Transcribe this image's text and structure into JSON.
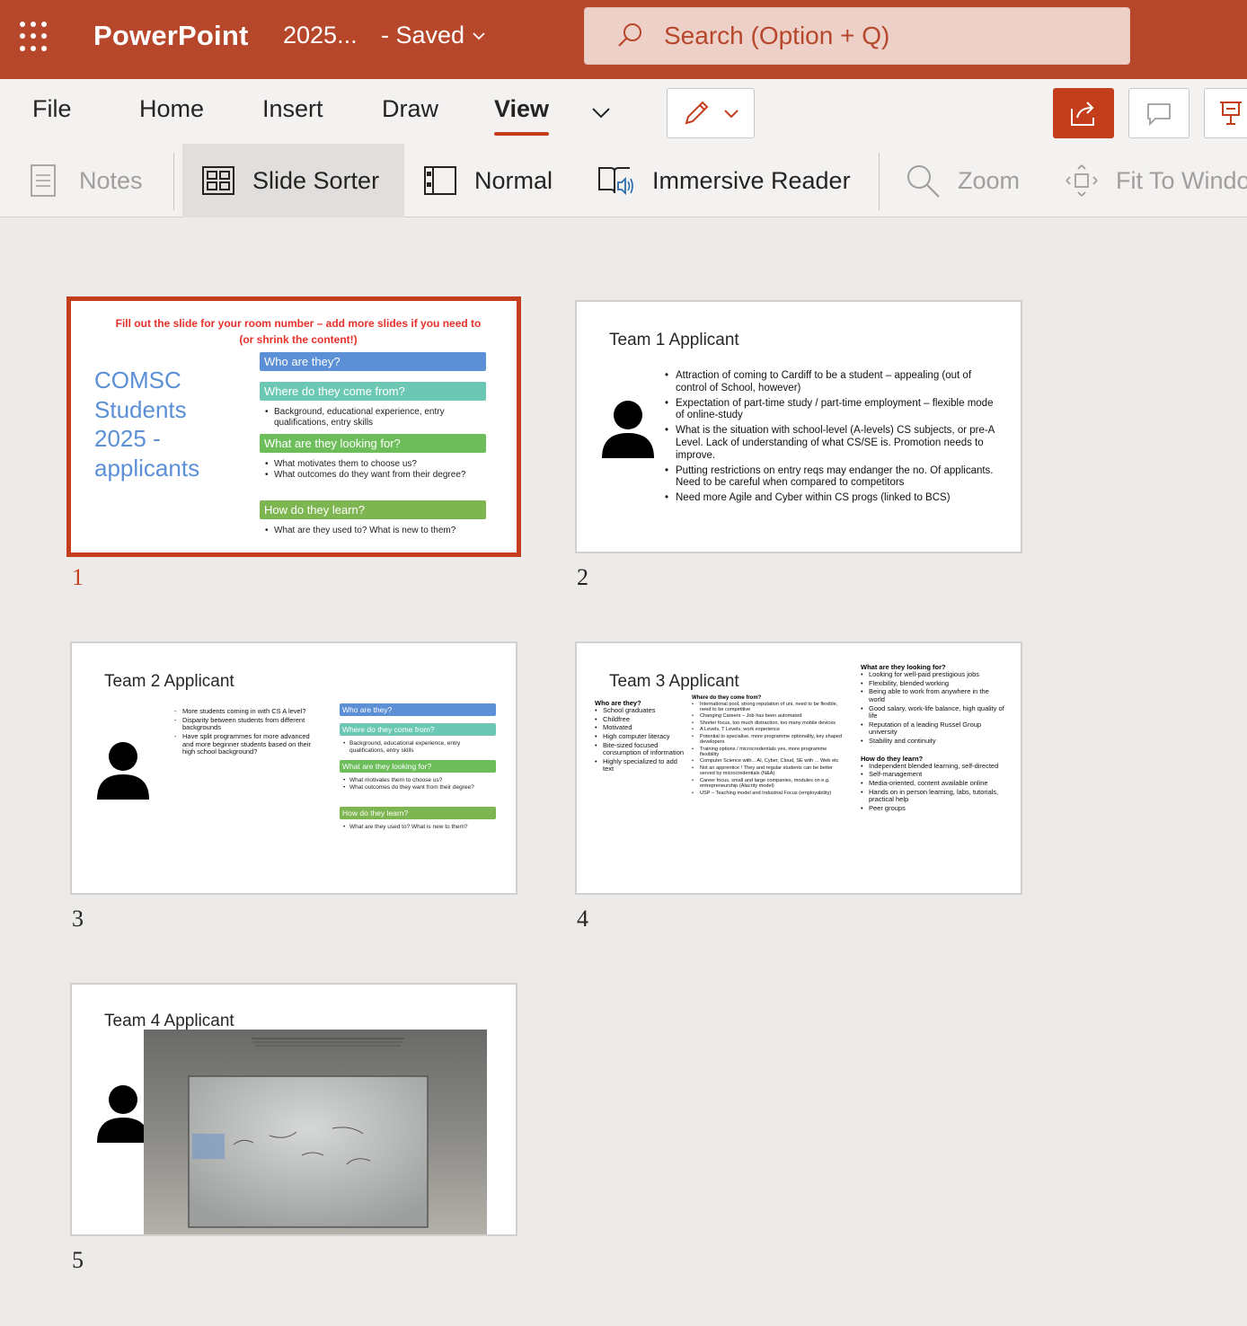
{
  "app": {
    "name": "PowerPoint",
    "doc_title": "2025...",
    "save_status": "-  Saved",
    "search_placeholder": "Search (Option + Q)"
  },
  "tabs": [
    "File",
    "Home",
    "Insert",
    "Draw",
    "View"
  ],
  "active_tab": "View",
  "commands": {
    "notes": "Notes",
    "slide_sorter": "Slide Sorter",
    "normal": "Normal",
    "immersive_reader": "Immersive Reader",
    "zoom": "Zoom",
    "fit_to_window": "Fit To Windo"
  },
  "colors": {
    "brand": "#b7472a",
    "accent": "#c43e1c"
  },
  "slides": [
    {
      "number": "1",
      "selected": true,
      "instruction": "Fill out the slide for your room number – add more slides if you need to (or shrink the content!)",
      "title_lines": [
        "COMSC",
        "Students",
        "2025 -",
        "applicants"
      ],
      "boxes": [
        {
          "label": "Who are they?",
          "bullets": []
        },
        {
          "label": "Where do they come from?",
          "bullets": [
            "Background, educational experience, entry qualifications, entry skills"
          ]
        },
        {
          "label": "What are they looking for?",
          "bullets": [
            "What motivates them to choose us?",
            "What outcomes do they want from their degree?"
          ]
        },
        {
          "label": "How do they learn?",
          "bullets": [
            "What are they used to? What is new to them?"
          ]
        }
      ]
    },
    {
      "number": "2",
      "title": "Team 1 Applicant",
      "bullets": [
        "Attraction of coming to Cardiff to be a student – appealing (out of control of School, however)",
        "Expectation of part-time study / part-time employment – flexible mode of online-study",
        "What is the situation with school-level (A-levels) CS subjects, or pre-A Level.  Lack of understanding of what CS/SE is.  Promotion needs to improve.",
        "Putting restrictions on entry reqs may endanger the no. Of applicants.  Need to be careful when compared to competitors",
        "Need more Agile and Cyber within CS progs (linked to BCS)"
      ]
    },
    {
      "number": "3",
      "title": "Team 2 Applicant",
      "bullets": [
        "More students coming in with CS A level?",
        "Disparity between students from different backgrounds",
        "Have split programmes for more advanced and more beginner students based on their high school background?"
      ],
      "boxes": [
        {
          "label": "Who are they?",
          "bullets": []
        },
        {
          "label": "Where do they come from?",
          "bullets": [
            "Background, educational experience, entry qualifications, entry skills"
          ]
        },
        {
          "label": "What are they looking for?",
          "bullets": [
            "What motivates them to choose us?",
            "What outcomes do they want from their degree?"
          ]
        },
        {
          "label": "How do they learn?",
          "bullets": [
            "What are they used to? What is new to them?"
          ]
        }
      ]
    },
    {
      "number": "4",
      "title": "Team 3 Applicant",
      "who_header": "Who are they?",
      "who": [
        "School graduates",
        "Childfree",
        "Motivated",
        "High computer literacy",
        "Bite-sized focused consumption of information",
        "Highly specialized to add text"
      ],
      "where_header": "Where do they come from?",
      "where": [
        "International pool, strong reputation of uni, need to be flexible, need to be competitive",
        "Changing Careers – Job has been automated",
        "Shorter focus, too much distraction, too many mobile devices",
        "A Levels, T Levels, work experience",
        "Potential to specialise, more programme optionality, key shaped developers",
        "Training options / microcredentials yes, more programme flexibility",
        "Computer Science with... AI, Cyber, Cloud, SE with ... Web etc",
        "Not an apprentice !  They and regular students can be better served by microcredentials (N&A)",
        "Career focus, small and large companies, modules on e.g. entrepreneurship (Alacrity model)",
        "USP – Teaching model and Industrial Focus (employability)"
      ],
      "looking_header": "What are they looking for?",
      "looking": [
        "Looking for well-paid prestigious jobs",
        "Flexibility, blended working",
        "Being able to work from anywhere in the world",
        "Good salary, work-life balance, high quality of life",
        "Reputation of a leading Russel Group university",
        "Stability and continuity"
      ],
      "learn_header": "How do they learn?",
      "learn": [
        "Independent blended learning, self-directed",
        "Self-management",
        "Media-oriented, content available online",
        "Hands on in person learning, labs, tutorials, practical help",
        "Peer groups"
      ]
    },
    {
      "number": "5",
      "title": "Team 4 Applicant"
    }
  ]
}
